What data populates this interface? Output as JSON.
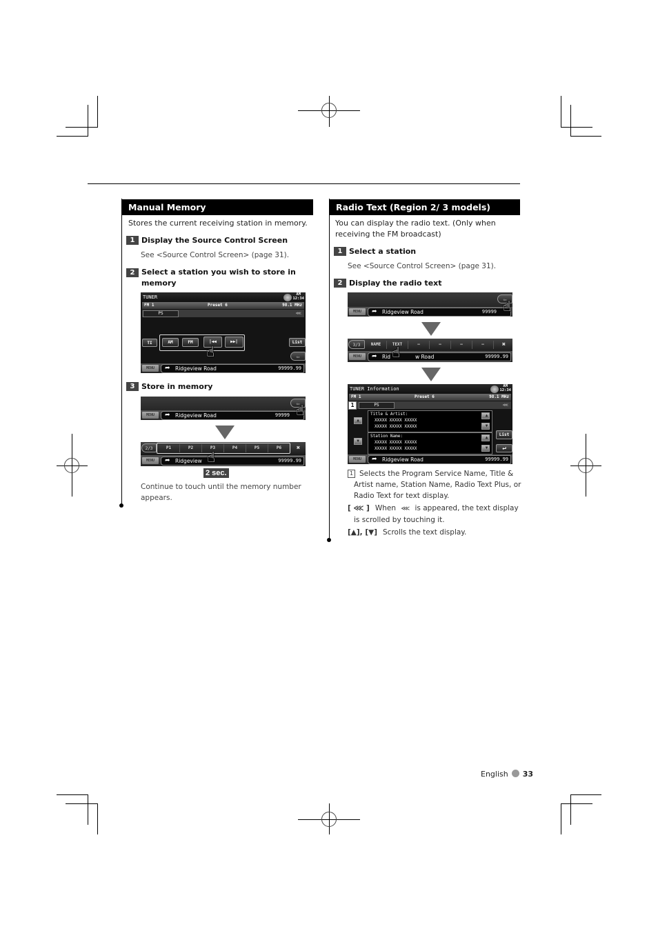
{
  "left": {
    "title": "Manual Memory",
    "intro": "Stores the current receiving station in memory.",
    "steps": [
      {
        "num": "1",
        "title": "Display the Source Control Screen",
        "detail": "See <Source Control Screen> (page 31)."
      },
      {
        "num": "2",
        "title": "Select a station you wish to store in memory"
      },
      {
        "num": "3",
        "title": "Store in memory"
      }
    ],
    "screen1": {
      "title": "TUNER",
      "clock_ampm": "AM",
      "clock_time": "12:34",
      "band": "FM 1",
      "preset": "Preset 6",
      "freq": "98.1 MHz",
      "ps": "PS",
      "scroll_icon": "⋘",
      "buttons": [
        "TI",
        "AM",
        "FM",
        "|◀◀",
        "▶▶|",
        "List"
      ],
      "menu": "MENU",
      "road": "Ridgeview Road",
      "distance": "99999.99"
    },
    "screen2": {
      "menu": "MENU",
      "road": "Ridgeview Road",
      "distance": "99999"
    },
    "screen3": {
      "page": "2/3",
      "presets": [
        "P1",
        "P2",
        "P3",
        "P4",
        "P5",
        "P6"
      ],
      "menu": "MENU",
      "road": "Ridgeview",
      "distance": "99999.99"
    },
    "hold_badge": "2 sec.",
    "note": "Continue to touch until the memory number appears."
  },
  "right": {
    "title": "Radio Text (Region 2/ 3 models)",
    "intro": "You can display the radio text. (Only when receiving the FM broadcast)",
    "steps": [
      {
        "num": "1",
        "title": "Select a station",
        "detail": "See <Source Control Screen> (page 31)."
      },
      {
        "num": "2",
        "title": "Display the radio text"
      }
    ],
    "screen1": {
      "menu": "MENU",
      "road": "Ridgeview Road",
      "distance": "99999"
    },
    "screen2": {
      "page": "3/3",
      "cells": [
        "NAME",
        "TEXT",
        "—",
        "—",
        "—",
        "—"
      ],
      "menu": "MENU",
      "road_left": "Rid",
      "road_right": "w Road",
      "distance": "99999.99"
    },
    "screen3": {
      "title": "TUNER Information",
      "clock_ampm": "AM",
      "clock_time": "12:34",
      "band": "FM 1",
      "preset": "Preset 6",
      "freq": "98.1 MHz",
      "callout": "1",
      "ps": "PS",
      "panel1_label": "Title & Artist:",
      "panel1_lines": [
        "XXXXX XXXXX XXXXX",
        "XXXXX XXXXX XXXXX"
      ],
      "panel2_label": "Station Name:",
      "panel2_lines": [
        "XXXXX XXXXX XXXXX",
        "XXXXX XXXXX XXXXX"
      ],
      "list": "List",
      "menu": "MENU",
      "road": "Ridgeview Road",
      "distance": "99999.99"
    },
    "notes": [
      {
        "key": "1",
        "text": "Selects the Program Service Name, Title & Artist name, Station Name, Radio Text Plus, or Radio Text for text display."
      },
      {
        "key": "[ ⋘ ]",
        "text_a": "When",
        "icon": "⋘",
        "text_b": "is appeared, the text display is scrolled by touching it."
      },
      {
        "key": "[▲], [▼]",
        "text": "Scrolls the text display."
      }
    ]
  },
  "footer": {
    "language": "English",
    "page": "33"
  }
}
